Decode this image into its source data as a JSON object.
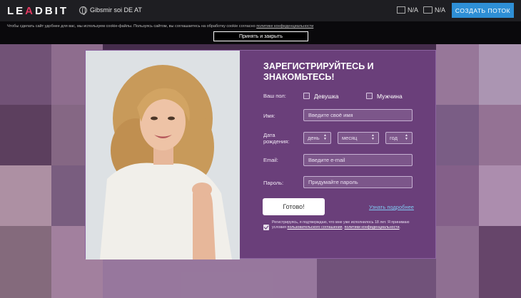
{
  "header": {
    "logo_part1": "LE",
    "logo_part2": "A",
    "logo_part3": "DBIT",
    "lander_name": "Gibsmir soi DE AT",
    "desktop_label": "N/A",
    "tablet_label": "N/A",
    "create_button": "СОЗДАТЬ ПОТОК"
  },
  "cookie": {
    "text": "Чтобы сделать сайт удобнее для вас, мы используем cookie-файлы. Пользуясь сайтом, вы соглашаетесь на обработку cookie согласно ",
    "link": "политике конфиденциальности",
    "accept_button": "Принять и закрыть"
  },
  "form": {
    "title": "ЗАРЕГИСТРИРУЙТЕСЬ И ЗНАКОМЬТЕСЬ!",
    "gender_label": "Ваш пол:",
    "gender_female": "Девушка",
    "gender_male": "Мужчина",
    "name_label": "Имя:",
    "name_placeholder": "Введите своё имя",
    "birth_label": "Дата рождения:",
    "day_placeholder": "день",
    "month_placeholder": "месяц",
    "year_placeholder": "год",
    "email_label": "Email:",
    "email_placeholder": "Введите e-mail",
    "password_label": "Пароль:",
    "password_placeholder": "Придумайте пароль",
    "submit": "Готово!",
    "more_link": "Узнать подробнее",
    "agree_text": "Регистрируясь, я подтверждаю, что мне уже исполнилось 18 лет. Я принимаю условия ",
    "agree_link1": "пользовательского соглашения",
    "agree_sep": ", ",
    "agree_link2": "политики конфиденциальности",
    "agree_end": "."
  },
  "colors": {
    "accent": "#2e8fd6",
    "modal_bg": "#6a3f7a",
    "logo_accent": "#e23a62"
  }
}
